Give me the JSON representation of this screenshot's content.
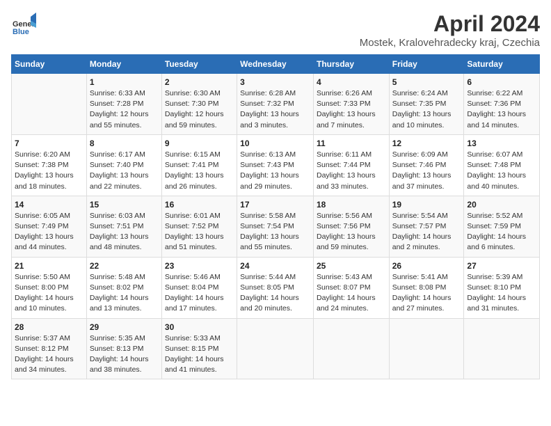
{
  "header": {
    "logo": {
      "general": "General",
      "blue": "Blue"
    },
    "title": "April 2024",
    "location": "Mostek, Kralovehradecky kraj, Czechia"
  },
  "calendar": {
    "weekdays": [
      "Sunday",
      "Monday",
      "Tuesday",
      "Wednesday",
      "Thursday",
      "Friday",
      "Saturday"
    ],
    "weeks": [
      [
        {
          "day": "",
          "info": ""
        },
        {
          "day": "1",
          "info": "Sunrise: 6:33 AM\nSunset: 7:28 PM\nDaylight: 12 hours\nand 55 minutes."
        },
        {
          "day": "2",
          "info": "Sunrise: 6:30 AM\nSunset: 7:30 PM\nDaylight: 12 hours\nand 59 minutes."
        },
        {
          "day": "3",
          "info": "Sunrise: 6:28 AM\nSunset: 7:32 PM\nDaylight: 13 hours\nand 3 minutes."
        },
        {
          "day": "4",
          "info": "Sunrise: 6:26 AM\nSunset: 7:33 PM\nDaylight: 13 hours\nand 7 minutes."
        },
        {
          "day": "5",
          "info": "Sunrise: 6:24 AM\nSunset: 7:35 PM\nDaylight: 13 hours\nand 10 minutes."
        },
        {
          "day": "6",
          "info": "Sunrise: 6:22 AM\nSunset: 7:36 PM\nDaylight: 13 hours\nand 14 minutes."
        }
      ],
      [
        {
          "day": "7",
          "info": "Sunrise: 6:20 AM\nSunset: 7:38 PM\nDaylight: 13 hours\nand 18 minutes."
        },
        {
          "day": "8",
          "info": "Sunrise: 6:17 AM\nSunset: 7:40 PM\nDaylight: 13 hours\nand 22 minutes."
        },
        {
          "day": "9",
          "info": "Sunrise: 6:15 AM\nSunset: 7:41 PM\nDaylight: 13 hours\nand 26 minutes."
        },
        {
          "day": "10",
          "info": "Sunrise: 6:13 AM\nSunset: 7:43 PM\nDaylight: 13 hours\nand 29 minutes."
        },
        {
          "day": "11",
          "info": "Sunrise: 6:11 AM\nSunset: 7:44 PM\nDaylight: 13 hours\nand 33 minutes."
        },
        {
          "day": "12",
          "info": "Sunrise: 6:09 AM\nSunset: 7:46 PM\nDaylight: 13 hours\nand 37 minutes."
        },
        {
          "day": "13",
          "info": "Sunrise: 6:07 AM\nSunset: 7:48 PM\nDaylight: 13 hours\nand 40 minutes."
        }
      ],
      [
        {
          "day": "14",
          "info": "Sunrise: 6:05 AM\nSunset: 7:49 PM\nDaylight: 13 hours\nand 44 minutes."
        },
        {
          "day": "15",
          "info": "Sunrise: 6:03 AM\nSunset: 7:51 PM\nDaylight: 13 hours\nand 48 minutes."
        },
        {
          "day": "16",
          "info": "Sunrise: 6:01 AM\nSunset: 7:52 PM\nDaylight: 13 hours\nand 51 minutes."
        },
        {
          "day": "17",
          "info": "Sunrise: 5:58 AM\nSunset: 7:54 PM\nDaylight: 13 hours\nand 55 minutes."
        },
        {
          "day": "18",
          "info": "Sunrise: 5:56 AM\nSunset: 7:56 PM\nDaylight: 13 hours\nand 59 minutes."
        },
        {
          "day": "19",
          "info": "Sunrise: 5:54 AM\nSunset: 7:57 PM\nDaylight: 14 hours\nand 2 minutes."
        },
        {
          "day": "20",
          "info": "Sunrise: 5:52 AM\nSunset: 7:59 PM\nDaylight: 14 hours\nand 6 minutes."
        }
      ],
      [
        {
          "day": "21",
          "info": "Sunrise: 5:50 AM\nSunset: 8:00 PM\nDaylight: 14 hours\nand 10 minutes."
        },
        {
          "day": "22",
          "info": "Sunrise: 5:48 AM\nSunset: 8:02 PM\nDaylight: 14 hours\nand 13 minutes."
        },
        {
          "day": "23",
          "info": "Sunrise: 5:46 AM\nSunset: 8:04 PM\nDaylight: 14 hours\nand 17 minutes."
        },
        {
          "day": "24",
          "info": "Sunrise: 5:44 AM\nSunset: 8:05 PM\nDaylight: 14 hours\nand 20 minutes."
        },
        {
          "day": "25",
          "info": "Sunrise: 5:43 AM\nSunset: 8:07 PM\nDaylight: 14 hours\nand 24 minutes."
        },
        {
          "day": "26",
          "info": "Sunrise: 5:41 AM\nSunset: 8:08 PM\nDaylight: 14 hours\nand 27 minutes."
        },
        {
          "day": "27",
          "info": "Sunrise: 5:39 AM\nSunset: 8:10 PM\nDaylight: 14 hours\nand 31 minutes."
        }
      ],
      [
        {
          "day": "28",
          "info": "Sunrise: 5:37 AM\nSunset: 8:12 PM\nDaylight: 14 hours\nand 34 minutes."
        },
        {
          "day": "29",
          "info": "Sunrise: 5:35 AM\nSunset: 8:13 PM\nDaylight: 14 hours\nand 38 minutes."
        },
        {
          "day": "30",
          "info": "Sunrise: 5:33 AM\nSunset: 8:15 PM\nDaylight: 14 hours\nand 41 minutes."
        },
        {
          "day": "",
          "info": ""
        },
        {
          "day": "",
          "info": ""
        },
        {
          "day": "",
          "info": ""
        },
        {
          "day": "",
          "info": ""
        }
      ]
    ]
  }
}
